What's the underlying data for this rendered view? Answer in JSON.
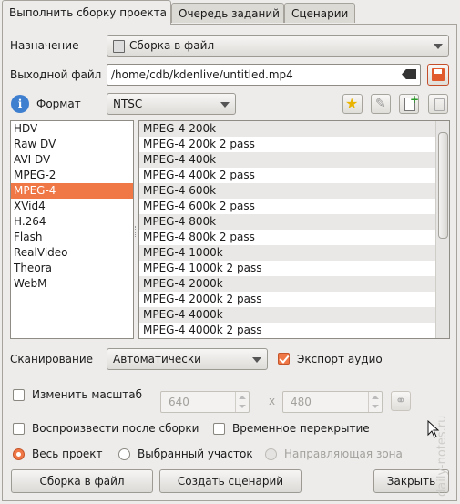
{
  "tabs": [
    {
      "label": "Выполнить сборку проекта",
      "active": true
    },
    {
      "label": "Очередь заданий",
      "active": false
    },
    {
      "label": "Сценарии",
      "active": false
    }
  ],
  "destination": {
    "label": "Назначение",
    "value": "Сборка в файл"
  },
  "output_file": {
    "label": "Выходной файл",
    "value": "/home/cdb/kdenlive/untitled.mp4"
  },
  "format": {
    "label": "Формат",
    "standard": "NTSC"
  },
  "format_list": [
    "HDV",
    "Raw DV",
    "AVI DV",
    "MPEG-2",
    "MPEG-4",
    "XVid4",
    "H.264",
    "Flash",
    "RealVideo",
    "Theora",
    "WebM"
  ],
  "format_selected": "MPEG-4",
  "profiles": [
    "MPEG-4 200k",
    "MPEG-4 200k 2 pass",
    "MPEG-4 400k",
    "MPEG-4 400k 2 pass",
    "MPEG-4 600k",
    "MPEG-4 600k 2 pass",
    "MPEG-4 800k",
    "MPEG-4 800k 2 pass",
    "MPEG-4 1000k",
    "MPEG-4 1000k 2 pass",
    "MPEG-4 2000k",
    "MPEG-4 2000k 2 pass",
    "MPEG-4 4000k",
    "MPEG-4 4000k 2 pass"
  ],
  "scanning": {
    "label": "Сканирование",
    "value": "Автоматически"
  },
  "export_audio": {
    "label": "Экспорт аудио",
    "checked": true
  },
  "rescale": {
    "label": "Изменить масштаб",
    "width": "640",
    "sep": "x",
    "height": "480",
    "checked": false
  },
  "play_after": {
    "label": "Воспроизвести после сборки",
    "checked": false
  },
  "overlay": {
    "label": "Временное перекрытие",
    "checked": false
  },
  "range": {
    "whole": "Весь проект",
    "selected": "Выбранный участок",
    "guide": "Направляющая зона",
    "current": "whole"
  },
  "buttons": {
    "render": "Сборка в файл",
    "script": "Создать сценарий",
    "close": "Закрыть"
  },
  "watermark": "daily-notes.ru",
  "colors": {
    "accent": "#f07746",
    "selected_text": "#ffffff"
  }
}
